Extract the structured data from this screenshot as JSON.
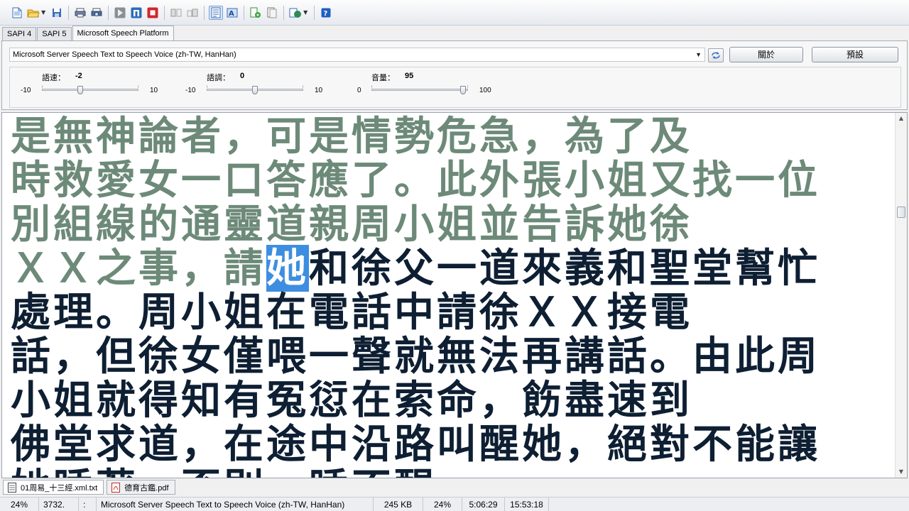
{
  "toolbar": {
    "buttons": [
      {
        "name": "new-file-icon"
      },
      {
        "name": "open-folder-icon"
      },
      {
        "name": "save-icon"
      },
      {
        "name": "print-icon"
      },
      {
        "name": "print-preview-icon"
      },
      {
        "name": "play-icon"
      },
      {
        "name": "pause-icon"
      },
      {
        "name": "stop-icon"
      },
      {
        "name": "skip-back-icon"
      },
      {
        "name": "skip-forward-icon"
      },
      {
        "name": "text-view-icon"
      },
      {
        "name": "font-icon"
      },
      {
        "name": "export-audio-icon"
      },
      {
        "name": "split-audio-icon"
      },
      {
        "name": "voice-options-icon"
      },
      {
        "name": "help-icon"
      }
    ]
  },
  "tabs": [
    {
      "label": "SAPI 4"
    },
    {
      "label": "SAPI 5"
    },
    {
      "label": "Microsoft Speech Platform",
      "active": true
    }
  ],
  "voice": {
    "selected": "Microsoft Server Speech Text to Speech Voice (zh-TW, HanHan)"
  },
  "buttons": {
    "about": "關於",
    "defaults": "預設"
  },
  "params": {
    "rate": {
      "label": "語速：",
      "value": "-2",
      "min": "-10",
      "max": "10",
      "level": 0.4
    },
    "pitch": {
      "label": "語調：",
      "value": "0",
      "min": "-10",
      "max": "10",
      "level": 0.5
    },
    "volume": {
      "label": "音量：",
      "value": "95",
      "min": "0",
      "max": "100",
      "level": 0.95
    }
  },
  "reader": {
    "lines": [
      {
        "read": "是無神論者，可是情勢危急，為了及",
        "hl": "",
        "unread": ""
      },
      {
        "read": "時救愛女一口答應了。此外張小姐又找一位",
        "hl": "",
        "unread": ""
      },
      {
        "read": "別組線的通靈道親周小姐並告訴她徐",
        "hl": "",
        "unread": ""
      },
      {
        "read": "ＸＸ之事，請",
        "hl": "她",
        "unread": "和徐父一道來義和聖堂幫忙"
      },
      {
        "read": "",
        "hl": "",
        "unread": "處理。周小姐在電話中請徐ＸＸ接電"
      },
      {
        "read": "",
        "hl": "",
        "unread": "話，但徐女僅喂一聲就無法再講話。由此周"
      },
      {
        "read": "",
        "hl": "",
        "unread": "小姐就得知有冤愆在索命，飭盡速到"
      },
      {
        "read": "",
        "hl": "",
        "unread": "佛堂求道，在途中沿路叫醒她，絕對不能讓"
      },
      {
        "read": "",
        "hl": "",
        "unread": "她睡著，否則一睡不醒。"
      }
    ]
  },
  "doc_tabs": [
    {
      "label": "01周易_十三經.xml.txt",
      "icon": "text-file-icon",
      "active": true
    },
    {
      "label": "德育古鑑.pdf",
      "icon": "pdf-file-icon",
      "active": false
    }
  ],
  "status": {
    "progress": "24%",
    "position": "3732.",
    "mode": ":",
    "voice": "Microsoft Server Speech Text to Speech Voice (zh-TW, HanHan)",
    "size": "245 KB",
    "percent": "24%",
    "elapsed": "5:06:29",
    "time": "15:53:18"
  }
}
